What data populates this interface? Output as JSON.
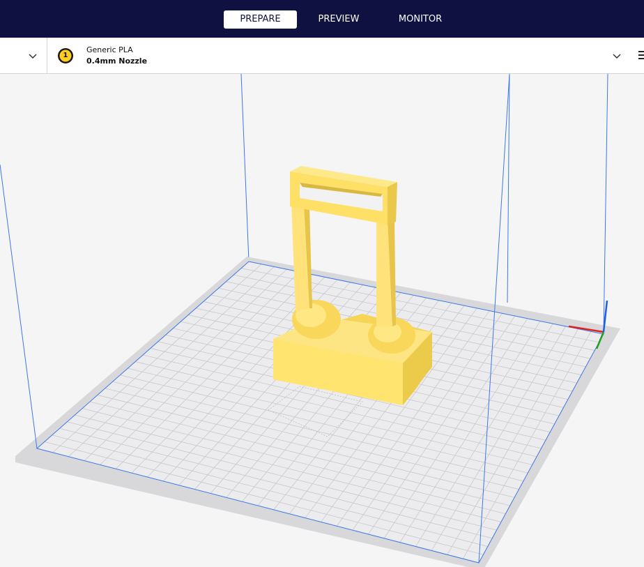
{
  "tabs": [
    {
      "label": "PREPARE",
      "active": true
    },
    {
      "label": "PREVIEW",
      "active": false
    },
    {
      "label": "MONITOR",
      "active": false
    }
  ],
  "extruder": {
    "number": "1",
    "material": "Generic PLA",
    "nozzle": "0.4mm Nozzle"
  },
  "colors": {
    "header_bg": "#0f1240",
    "model_fill": "#ffe374",
    "model_shadow": "#f2c84b",
    "build_volume_edge": "#3b78e7",
    "grid_line": "#c8c8cc",
    "axis_x": "#e02020",
    "axis_y": "#20a020",
    "axis_z": "#2060e0"
  },
  "icons": {
    "printer_dropdown": "chevron-down-icon",
    "material_dropdown": "chevron-down-icon",
    "extruder_badge": "extruder-icon",
    "print_settings": "menu-icon"
  }
}
